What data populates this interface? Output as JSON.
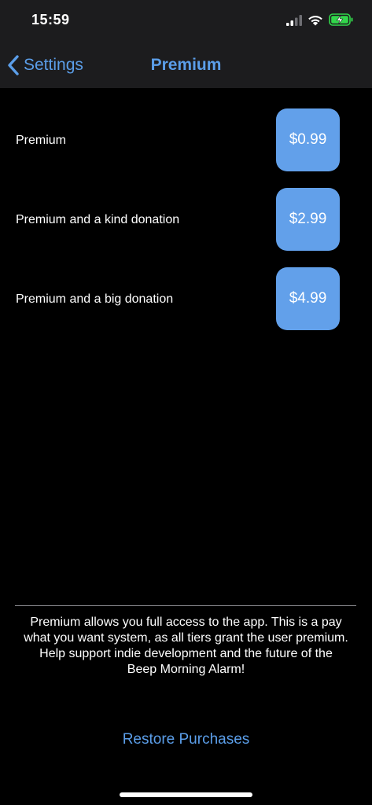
{
  "status_bar": {
    "time": "15:59",
    "icons": [
      "signal-icon",
      "wifi-icon",
      "battery-charging-icon"
    ],
    "battery_color": "#32d74b"
  },
  "nav": {
    "back_label": "Settings",
    "back_icon": "chevron-left-icon",
    "title": "Premium"
  },
  "tiers": [
    {
      "label": "Premium",
      "price": "$0.99"
    },
    {
      "label": "Premium and a kind donation",
      "price": "$2.99"
    },
    {
      "label": "Premium and a big donation",
      "price": "$4.99"
    }
  ],
  "description": "Premium allows you full access to the app. This is a pay what you want system, as all tiers grant the user premium. Help support indie development and the future of the Beep Morning Alarm!",
  "restore_label": "Restore Purchases",
  "colors": {
    "accent": "#5b9ee9",
    "price_button": "#62a0ea",
    "background": "#000000",
    "bar_background": "#1c1c1e"
  }
}
